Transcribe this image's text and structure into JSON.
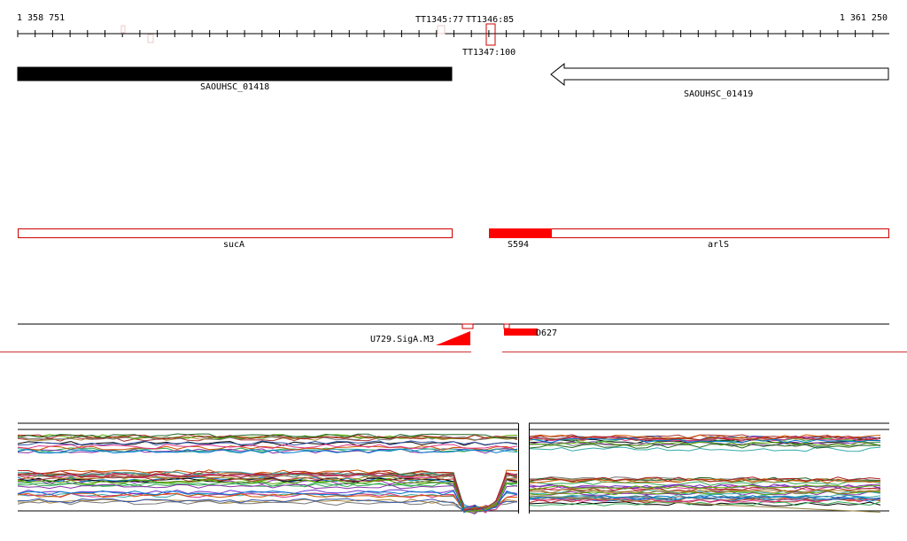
{
  "ruler": {
    "start_label": "1 358 751",
    "end_label": "1 361 250",
    "terminators": [
      "TT1345:77",
      "TT1346:85",
      "TT1347:100"
    ]
  },
  "genes": {
    "left": {
      "name": "SAOUHSC_01418",
      "strand": "+",
      "fill": "#000000"
    },
    "right": {
      "name": "SAOUHSC_01419",
      "strand": "-",
      "fill": "#ffffff"
    }
  },
  "transcripts": {
    "left": {
      "name": "sucA"
    },
    "right_highlight": {
      "name": "S594"
    },
    "right": {
      "name": "arlS"
    }
  },
  "promoters": {
    "left": {
      "name": "U729.SigA.M3"
    },
    "right": {
      "name": "D627"
    }
  },
  "colors": {
    "accent": "#ff0000",
    "outline_red": "#cc0000",
    "text": "#000000",
    "separator": "#cc3333"
  },
  "expression": {
    "palette": [
      "#000000",
      "#aa3333",
      "#3355aa",
      "#33aa55",
      "#aa8833",
      "#8833aa",
      "#33aaaa",
      "#cc5500",
      "#777777",
      "#dd3388",
      "#55aa00",
      "#0077cc",
      "#aa2222",
      "#226622",
      "#996633",
      "#6633cc"
    ]
  }
}
